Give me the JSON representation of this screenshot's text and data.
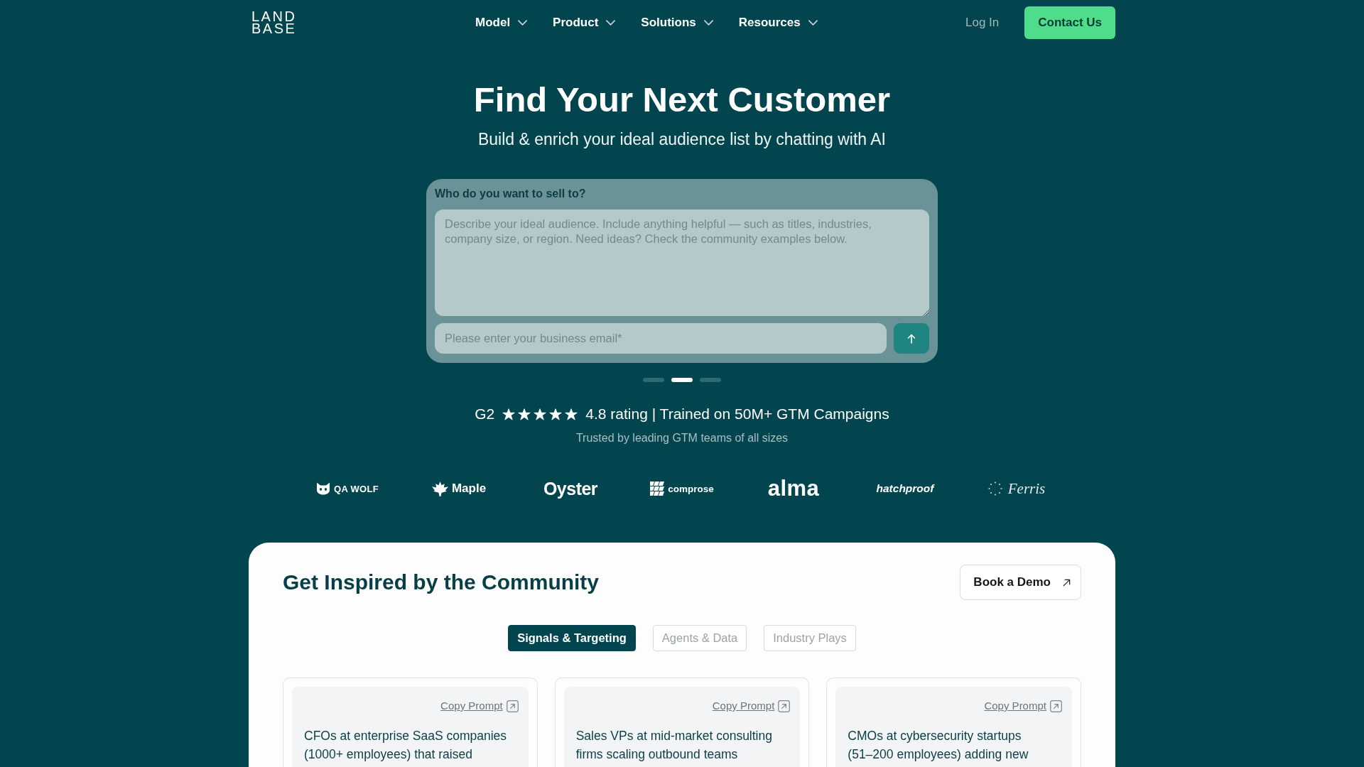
{
  "header": {
    "logo": [
      "LAND",
      "BASE"
    ],
    "nav": [
      {
        "label": "Model"
      },
      {
        "label": "Product"
      },
      {
        "label": "Solutions"
      },
      {
        "label": "Resources"
      }
    ],
    "login": "Log In",
    "contact": "Contact Us"
  },
  "hero": {
    "title": "Find Your Next Customer",
    "subtitle": "Build & enrich your ideal audience list by chatting with AI"
  },
  "prompt_form": {
    "label": "Who do you want to sell to?",
    "audience_field": {
      "placeholder": "Describe your ideal audience. Include anything helpful — such as titles, industries, company size, or region. Need ideas? Check the community examples below."
    },
    "email_field": {
      "placeholder": "Please enter your business email*"
    }
  },
  "carousel_dots": [
    {
      "selected": false
    },
    {
      "selected": true
    },
    {
      "selected": false
    }
  ],
  "rating": {
    "source": "G2",
    "stars": 5,
    "text": "4.8 rating | Trained on 50M+ GTM Campaigns"
  },
  "trusted": "Trusted by leading GTM teams of all sizes",
  "logos": [
    {
      "kind": "cat",
      "wordmark": "QA WOLF"
    },
    {
      "kind": "leaf",
      "wordmark": "Maple"
    },
    {
      "kind": "plain",
      "wordmark": "Oyster"
    },
    {
      "kind": "grid",
      "wordmark": "comprose"
    },
    {
      "kind": "heavy",
      "wordmark": "alma"
    },
    {
      "kind": "slanted",
      "wordmark": "hatchproof"
    },
    {
      "kind": "dotted",
      "wordmark": "Ferris"
    }
  ],
  "community": {
    "title": "Get Inspired by the Community",
    "demo_button": "Book a Demo",
    "tabs": [
      {
        "label": "Signals & Targeting",
        "selected": true
      },
      {
        "label": "Agents & Data",
        "selected": false
      },
      {
        "label": "Industry Plays",
        "selected": false
      }
    ],
    "cards": [
      {
        "action": "Copy Prompt",
        "text": "CFOs at enterprise SaaS companies (1000+ employees) that raised"
      },
      {
        "action": "Copy Prompt",
        "text": "Sales VPs at mid-market consulting firms scaling outbound teams"
      },
      {
        "action": "Copy Prompt",
        "text": "CMOs at cybersecurity startups (51–200 employees) adding new"
      }
    ]
  }
}
